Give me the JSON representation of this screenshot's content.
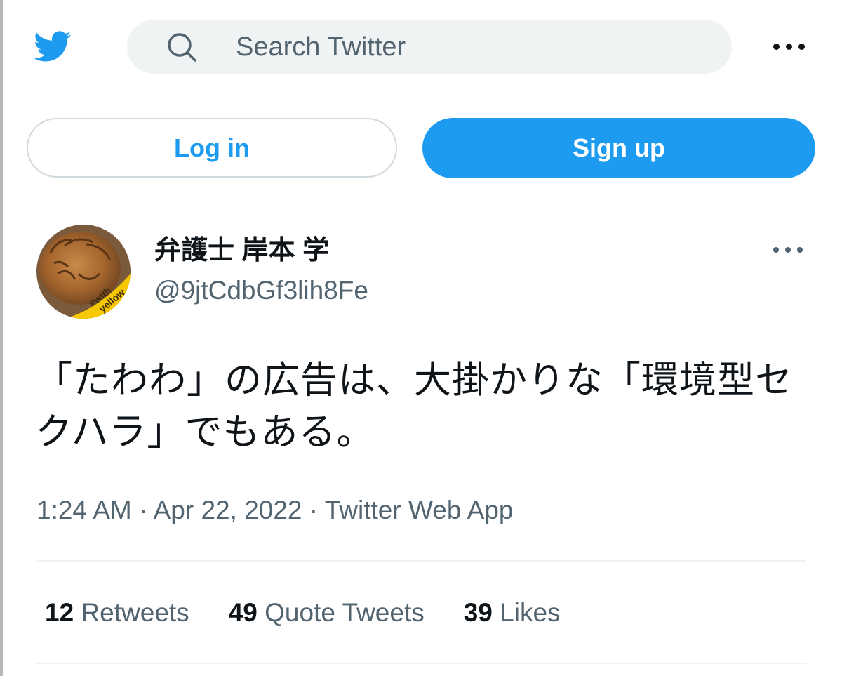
{
  "header": {
    "logo_icon": "twitter-bird-icon",
    "search": {
      "placeholder": "Search Twitter",
      "icon": "search-icon"
    },
    "more_icon": "more-horizontal-icon"
  },
  "auth": {
    "login_label": "Log in",
    "signup_label": "Sign up"
  },
  "tweet": {
    "author": {
      "display_name": "弁護士 岸本 学",
      "handle": "@9jtCdbGf3lih8Fe",
      "avatar_badge": "#with yellow"
    },
    "text": "「たわわ」の広告は、大掛かりな「環境型セクハラ」でもある。",
    "time": "1:24 AM",
    "date": "Apr 22, 2022",
    "source": "Twitter Web App",
    "separator": "·",
    "stats": [
      {
        "count": "12",
        "label": "Retweets"
      },
      {
        "count": "49",
        "label": "Quote Tweets"
      },
      {
        "count": "39",
        "label": "Likes"
      }
    ]
  },
  "colors": {
    "brand_blue": "#1d9bf0",
    "search_bg": "#eff3f4",
    "secondary_text": "#536471",
    "primary_text": "#0f1419",
    "avatar_ring": "#f7c800"
  }
}
